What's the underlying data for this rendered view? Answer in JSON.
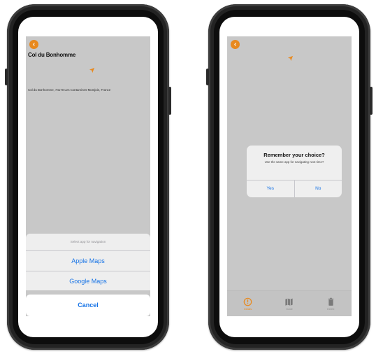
{
  "left_screen": {
    "back_icon": "chevron-left-icon",
    "title": "Col du Bonhomme",
    "address": "Col du Bonhomme, 74170 Les Contamines-Montjoie, France",
    "nav_icon": "navigation-arrow-icon",
    "action_sheet": {
      "header": "Select app for navigation",
      "options": [
        "Apple Maps",
        "Google Maps"
      ],
      "cancel": "Cancel"
    }
  },
  "right_screen": {
    "back_icon": "chevron-left-icon",
    "nav_icon": "navigation-arrow-icon",
    "alert": {
      "title": "Remember your choice?",
      "message": "Use the same app for navigating next time?",
      "yes": "Yes",
      "no": "No"
    },
    "tabs": [
      {
        "label": "Details",
        "icon": "info-circle-icon",
        "active": true
      },
      {
        "label": "Guide",
        "icon": "map-icon",
        "active": false
      },
      {
        "label": "Delete",
        "icon": "trash-icon",
        "active": false
      }
    ]
  },
  "colors": {
    "accent": "#e8891e",
    "link": "#1673e6",
    "map_background": "#c8c8c8",
    "phone_frame": "#232323"
  }
}
